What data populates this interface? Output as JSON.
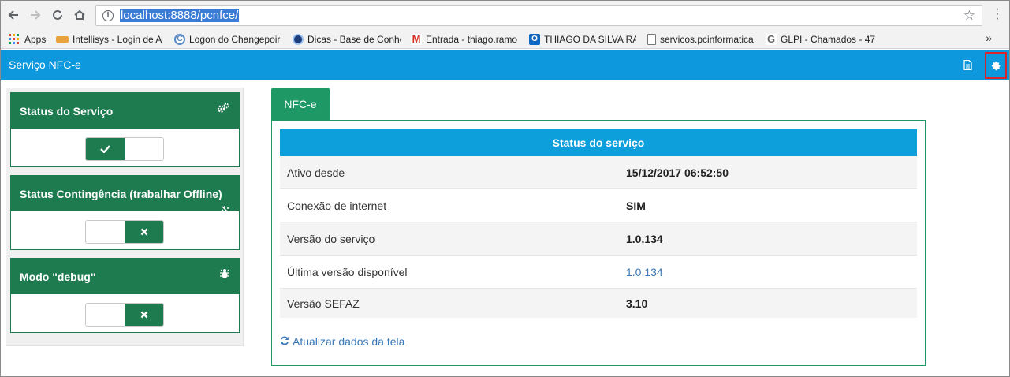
{
  "browser": {
    "url_highlighted": "localhost:8888/pcnfce/",
    "bookmarks": [
      {
        "label": "Apps",
        "icon": "apps-grid-icon"
      },
      {
        "label": "Intellisys - Login de A",
        "icon": "intellisys-favicon"
      },
      {
        "label": "Logon do Changepoir",
        "icon": "changepoint-favicon"
      },
      {
        "label": "Dicas - Base de Conhe",
        "icon": "dicas-favicon"
      },
      {
        "label": "Entrada - thiago.ramo",
        "icon": "gmail-icon"
      },
      {
        "label": "THIAGO DA SILVA RA",
        "icon": "outlook-icon"
      },
      {
        "label": "servicos.pcinformatica",
        "icon": "page-icon"
      },
      {
        "label": "GLPI - Chamados - 47",
        "icon": "glpi-favicon"
      }
    ],
    "more_bookmarks": "»"
  },
  "app": {
    "title": "Serviço NFC-e"
  },
  "sidebar": {
    "cards": [
      {
        "title": "Status do Serviço",
        "icon": "cogs-icon",
        "state": "on"
      },
      {
        "title": "Status Contingência (trabalhar Offline)",
        "icon": "plug-icon",
        "state": "off"
      },
      {
        "title": "Modo \"debug\"",
        "icon": "bug-icon",
        "state": "off"
      }
    ]
  },
  "main": {
    "tab": "NFC-e",
    "table_title": "Status do serviço",
    "rows": [
      {
        "label": "Ativo desde",
        "value": "15/12/2017 06:52:50"
      },
      {
        "label": "Conexão de internet",
        "value": "SIM"
      },
      {
        "label": "Versão do serviço",
        "value": "1.0.134"
      },
      {
        "label": "Última versão disponível",
        "value": "1.0.134"
      },
      {
        "label": "Versão SEFAZ",
        "value": "3.10"
      }
    ],
    "refresh_label": "Atualizar dados da tela"
  },
  "colors": {
    "navbar": "#0d97dc",
    "card_green": "#1e7b50",
    "tab_green": "#1e9966",
    "table_head": "#0d9fdc",
    "link": "#3a77b5",
    "highlight_box": "#d9252a"
  }
}
